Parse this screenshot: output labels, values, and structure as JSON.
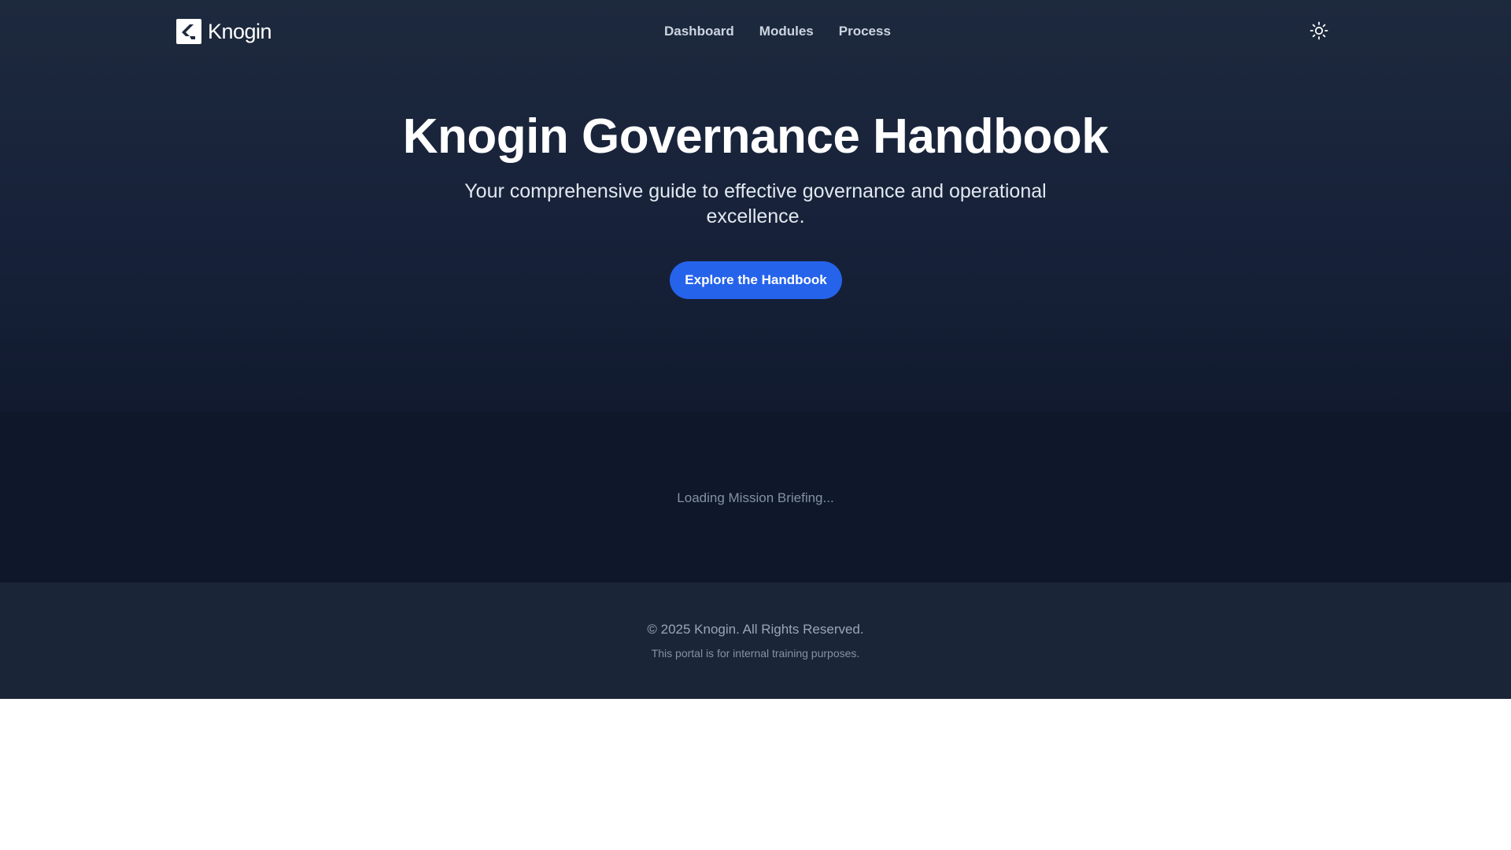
{
  "header": {
    "brand_name": "Knogin",
    "logo_icon": "knogin-k-icon",
    "nav": [
      {
        "label": "Dashboard"
      },
      {
        "label": "Modules"
      },
      {
        "label": "Process"
      }
    ],
    "theme_toggle_icon": "sun-icon"
  },
  "hero": {
    "title": "Knogin Governance Handbook",
    "subtitle": "Your comprehensive guide to effective governance and operational excellence.",
    "cta_label": "Explore the Handbook"
  },
  "briefing": {
    "status_text": "Loading Mission Briefing..."
  },
  "footer": {
    "copyright": "© 2025 Knogin. All Rights Reserved.",
    "note": "This portal is for internal training purposes."
  },
  "colors": {
    "hero_bg": "#1d293d",
    "briefing_bg": "#0f172a",
    "footer_bg": "#1b2538",
    "accent": "#2563eb"
  }
}
